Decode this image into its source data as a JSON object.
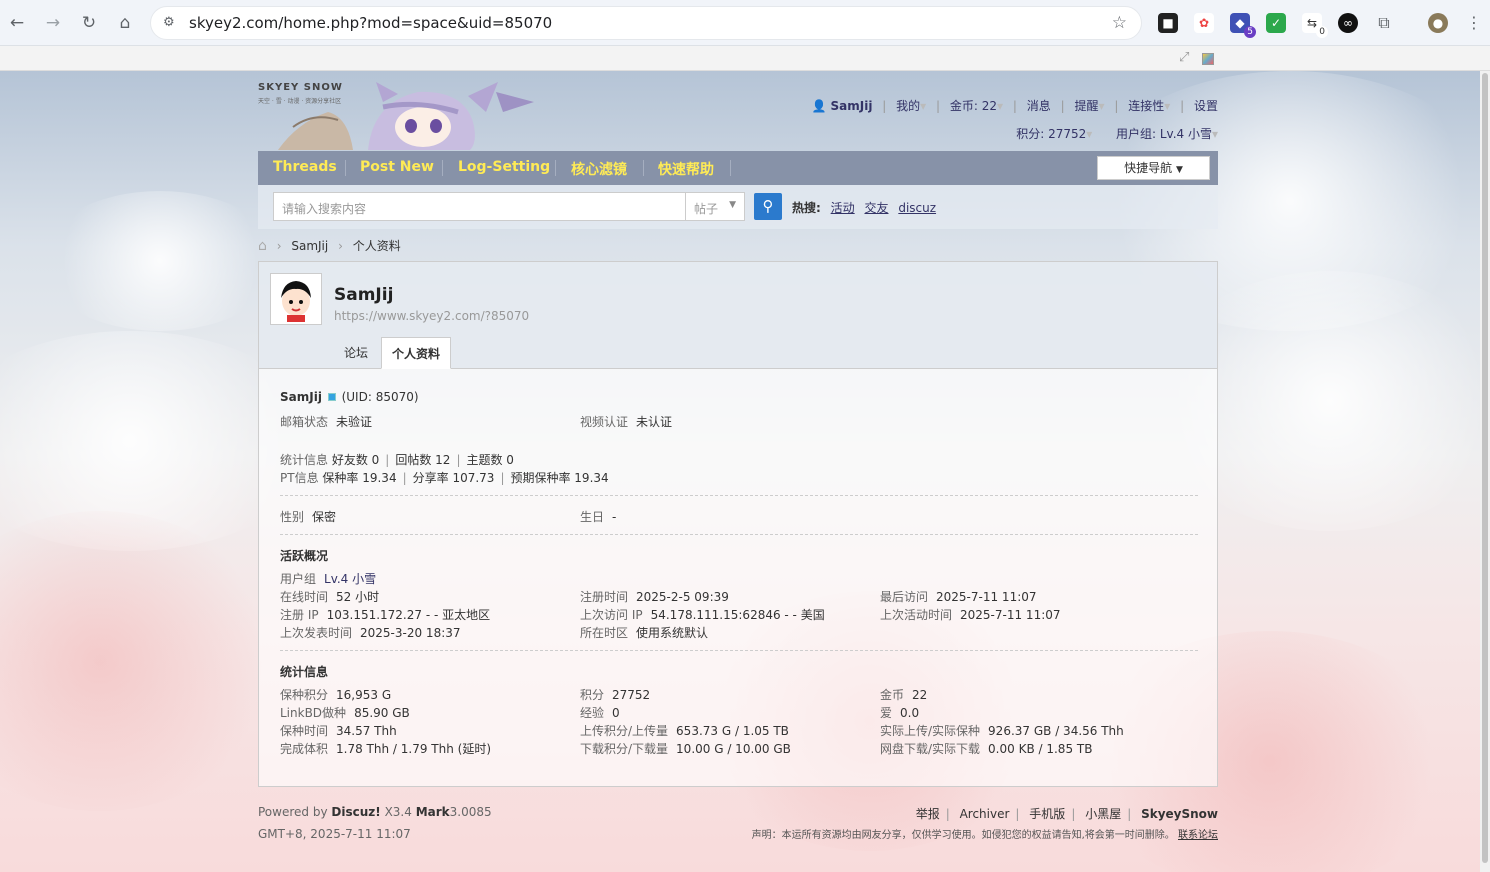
{
  "browser": {
    "url": "skyey2.com/home.php?mod=space&uid=85070",
    "ext_badge_1": "5",
    "ext_badge_2": "0"
  },
  "site": {
    "logo_title": "SKYEY SNOW",
    "logo_subtitle": "天空 · 雪 · 动漫 · 资源分享社区"
  },
  "user_menu": {
    "username": "SamJij",
    "my": "我的",
    "coins": "金币: 22",
    "messages": "消息",
    "reminders": "提醒",
    "connectivity": "连接性",
    "settings": "设置",
    "points": "积分: 27752",
    "usergroup": "用户组: Lv.4 小雪"
  },
  "nav": {
    "items": [
      "Threads",
      "Post New",
      "Log-Setting",
      "核心滤镜",
      "快速帮助"
    ],
    "quick_nav": "快捷导航"
  },
  "search": {
    "placeholder": "请输入搜索内容",
    "type": "帖子",
    "hot_label": "热搜:",
    "hot_items": [
      "活动",
      "交友",
      "discuz"
    ]
  },
  "breadcrumb": [
    "SamJij",
    "个人资料"
  ],
  "profile": {
    "name": "SamJij",
    "url": "https://www.skyey2.com/?85070",
    "tabs": [
      "论坛",
      "个人资料"
    ],
    "uid_text": "(UID: 85070)",
    "email_label": "邮箱状态",
    "email_value": "未验证",
    "video_label": "视频认证",
    "video_value": "未认证",
    "stats_label": "统计信息",
    "stats_friends": "好友数 0",
    "stats_replies": "回帖数 12",
    "stats_threads": "主题数 0",
    "pt_label": "PT信息",
    "pt_seed": "保种率 19.34",
    "pt_share": "分享率 107.73",
    "pt_expect": "预期保种率 19.34",
    "gender_label": "性别",
    "gender_value": "保密",
    "birthday_label": "生日",
    "birthday_value": "-",
    "activity_title": "活跃概况",
    "usergroup_label": "用户组",
    "usergroup_value": "Lv.4 小雪",
    "online_label": "在线时间",
    "online_value": "52 小时",
    "reg_time_label": "注册时间",
    "reg_time_value": "2025-2-5 09:39",
    "last_visit_label": "最后访问",
    "last_visit_value": "2025-7-11 11:07",
    "reg_ip_label": "注册 IP",
    "reg_ip_value": "103.151.172.27 - - 亚太地区",
    "last_ip_label": "上次访问 IP",
    "last_ip_value": "54.178.111.15:62846 - - 美国",
    "last_active_label": "上次活动时间",
    "last_active_value": "2025-7-11 11:07",
    "last_post_label": "上次发表时间",
    "last_post_value": "2025-3-20 18:37",
    "timezone_label": "所在时区",
    "timezone_value": "使用系统默认",
    "stats_title": "统计信息",
    "seed_points_label": "保种积分",
    "seed_points_value": "16,953 G",
    "points_label": "积分",
    "points_value": "27752",
    "coins_label": "金币",
    "coins_value": "22",
    "linkbd_label": "LinkBD做种",
    "linkbd_value": "85.90 GB",
    "exp_label": "经验",
    "exp_value": "0",
    "love_label": "爱",
    "love_value": "0.0",
    "seed_time_label": "保种时间",
    "seed_time_value": "34.57 Thh",
    "upload_label": "上传积分/上传量",
    "upload_value": "653.73 G / 1.05 TB",
    "real_upload_label": "实际上传/实际保种",
    "real_upload_value": "926.37 GB / 34.56 Thh",
    "volume_label": "完成体积",
    "volume_value": "1.78 Thh / 1.79 Thh (延时)",
    "download_label": "下载积分/下载量",
    "download_value": "10.00 G / 10.00 GB",
    "disk_label": "网盘下载/实际下载",
    "disk_value": "0.00 KB / 1.85 TB"
  },
  "footer": {
    "powered_prefix": "Powered by",
    "discuz": "Discuz!",
    "version": "X3.4",
    "mark": "Mark",
    "mark_version": "3.0085",
    "timezone": "GMT+8, 2025-7-11 11:07",
    "links": [
      "举报",
      "Archiver",
      "手机版",
      "小黑屋",
      "SkyeySnow"
    ],
    "disclaimer": "声明：本运所有资源均由网友分享，仅供学习使用。如侵犯您的权益请告知,将会第一时间删除。",
    "contact": "联系论坛"
  }
}
